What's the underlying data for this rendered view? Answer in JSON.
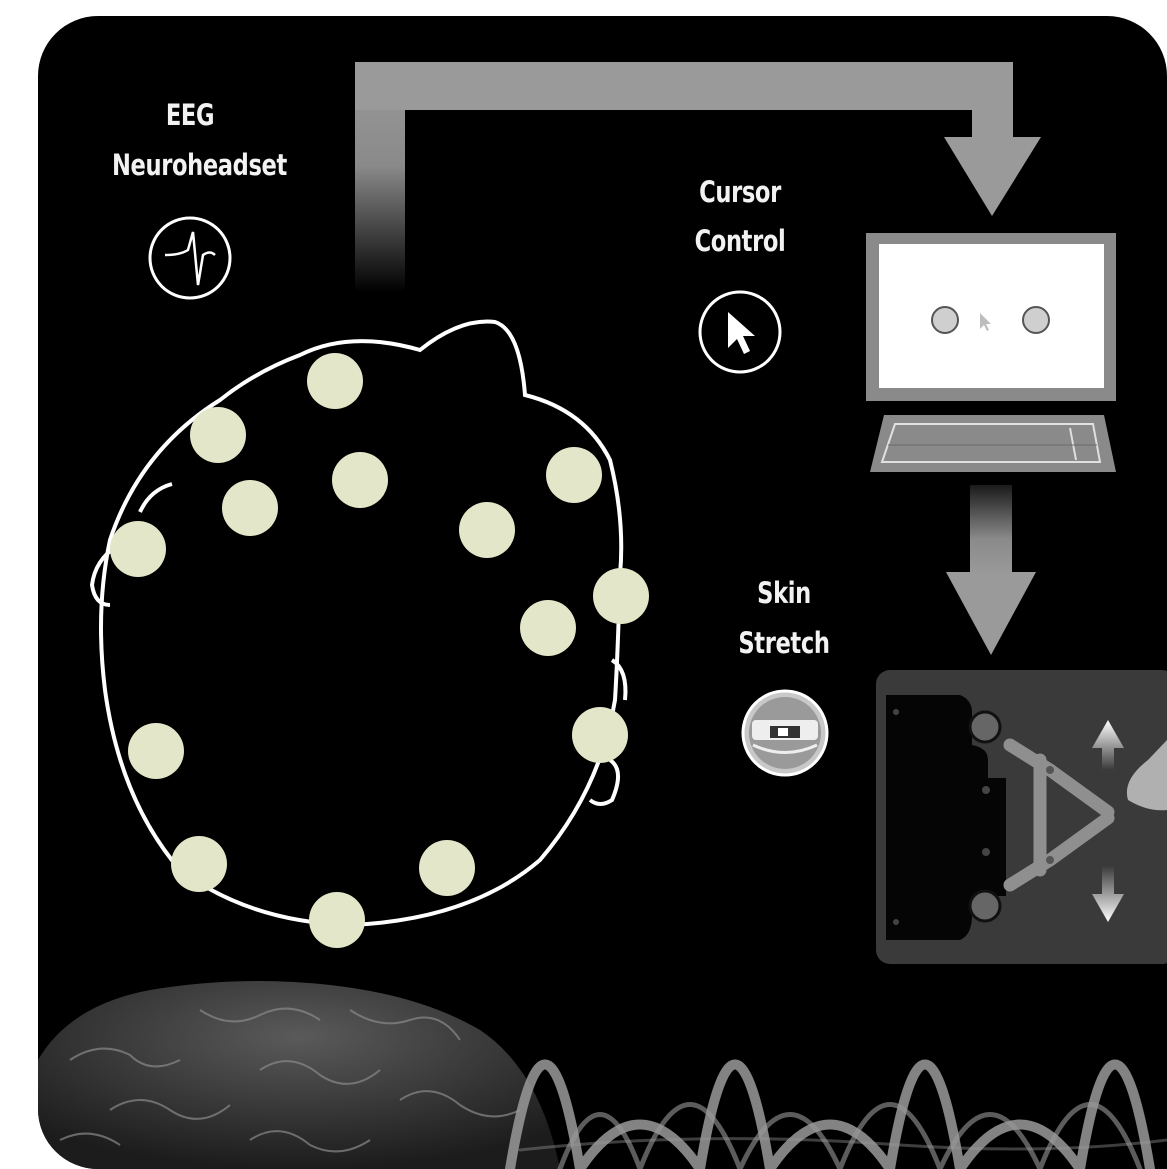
{
  "labels": {
    "eeg_line1": "EEG",
    "eeg_line2": "Neuroheadset",
    "cursor_line1": "Cursor",
    "cursor_line2": "Control",
    "skin_line1": "Skin",
    "skin_line2": "Stretch"
  },
  "icons": {
    "eeg": "eeg-waveform-icon",
    "cursor": "mouse-pointer-icon",
    "skin": "skin-stretch-device-icon"
  },
  "colors": {
    "background": "#000000",
    "electrode": "#e3e6c8",
    "arrow": "#8c8c8c",
    "text": "#f2f2f2"
  }
}
